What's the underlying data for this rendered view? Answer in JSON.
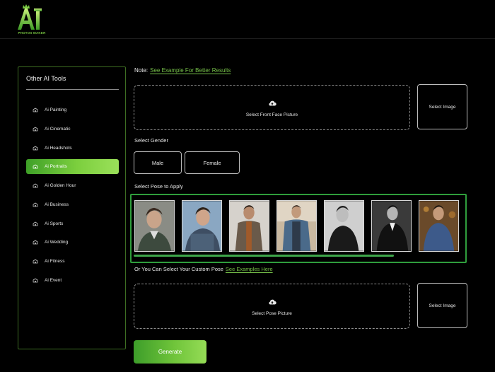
{
  "header": {
    "logo_text": "AI",
    "logo_sub": "PHOTOS MAKER"
  },
  "sidebar": {
    "title": "Other AI Tools",
    "items": [
      {
        "label": "Ai Painting",
        "icon": "tool-icon"
      },
      {
        "label": "Ai Cinematic",
        "icon": "tool-icon"
      },
      {
        "label": "Ai Headshots",
        "icon": "tool-icon"
      },
      {
        "label": "Ai Portraits",
        "icon": "tool-icon",
        "active": true
      },
      {
        "label": "Ai Golden Hour",
        "icon": "tool-icon"
      },
      {
        "label": "Ai Business",
        "icon": "tool-icon"
      },
      {
        "label": "Ai Sports",
        "icon": "tool-icon"
      },
      {
        "label": "Ai Wedding",
        "icon": "tool-icon"
      },
      {
        "label": "Ai Fitness",
        "icon": "tool-icon"
      },
      {
        "label": "Ai Event",
        "icon": "tool-icon"
      }
    ]
  },
  "main": {
    "note_label": "Note:",
    "note_link": "See Example For Better Results",
    "face_upload": {
      "label": "Select Front Face Picture",
      "icon": "cloud-upload-icon",
      "button": "Select Image"
    },
    "gender": {
      "label": "Select Gender",
      "options": [
        "Male",
        "Female"
      ]
    },
    "poses": {
      "label": "Select Pose to Apply",
      "count": 7
    },
    "custom_pose": {
      "text": "Or You Can Select Your Custom Pose",
      "link": "See Examples Here",
      "upload_label": "Select Pose Picture",
      "icon": "cloud-upload-icon",
      "button": "Select Image"
    },
    "generate_button": "Generate"
  },
  "colors": {
    "accent": "#78c34a",
    "border_green": "#2f9e3c",
    "background": "#000000"
  }
}
